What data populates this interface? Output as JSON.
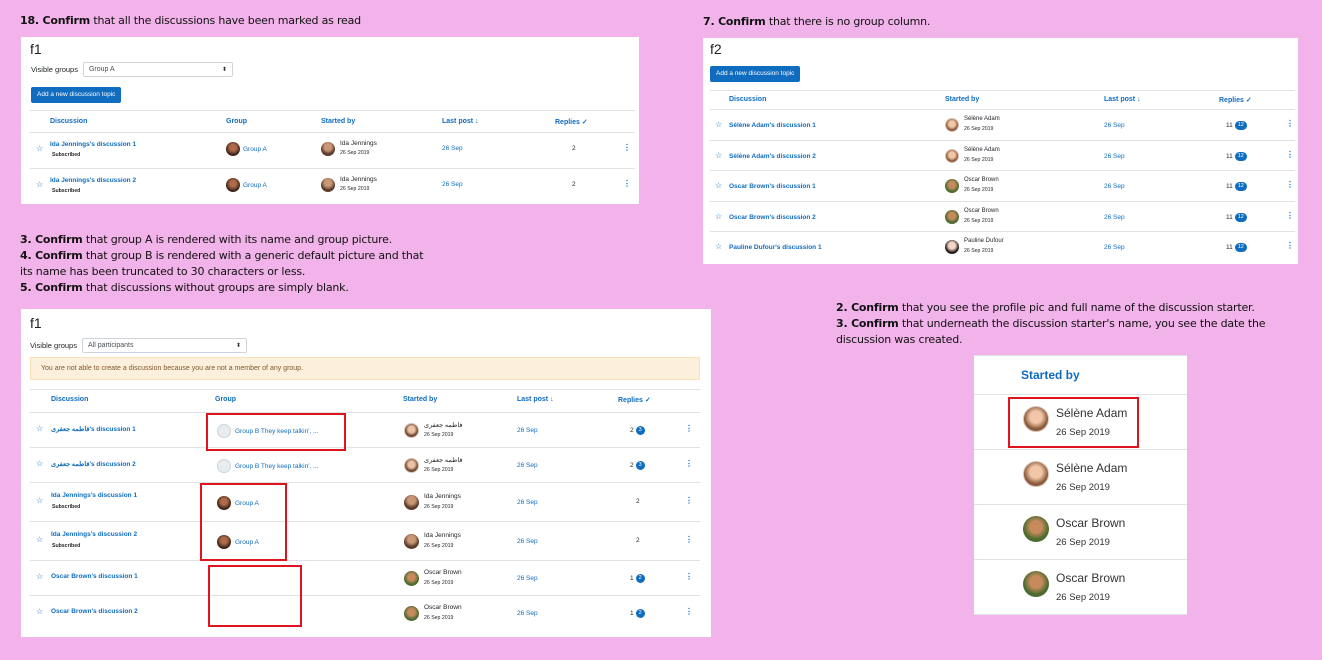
{
  "notes": {
    "n18_num": "18. ",
    "n18_bold": "Confirm",
    "n18_rest": " that all the discussions have been marked as read",
    "n7_num": "7. ",
    "n7_bold": "Confirm",
    "n7_rest": " that there  is no group column.",
    "n3_num": "3. ",
    "n3_bold": "Confirm",
    "n3_rest": " that group A is rendered with its name and group picture.",
    "n4_num": "4. ",
    "n4_bold": "Confirm",
    "n4_rest1": " that group B is rendered with a generic default picture and that",
    "n4_rest2": "its name has been truncated to 30 characters or less.",
    "n5_num": "5. ",
    "n5_bold": "Confirm",
    "n5_rest": " that discussions without groups are simply blank.",
    "n2b_num": "2. ",
    "n2b_bold": "Confirm",
    "n2b_rest": " that you see the profile pic and full name of the discussion starter.",
    "n3b_num": "3. ",
    "n3b_bold": "Confirm",
    "n3b_rest1": " that underneath the discussion starter's name, you see the date the",
    "n3b_rest2": "discussion was created."
  },
  "panel1": {
    "title": "f1",
    "visible_groups_label": "Visible groups",
    "group_select": "Group A",
    "add_button": "Add a new discussion topic",
    "headers": {
      "discussion": "Discussion",
      "group": "Group",
      "started_by": "Started by",
      "last_post": "Last post",
      "last_post_arrow": "↓",
      "replies": "Replies",
      "replies_check": "✓"
    },
    "rows": [
      {
        "title": "Ida Jennings's discussion 1",
        "sub": "Subscribed",
        "group": "Group A",
        "author": "Ida Jennings",
        "date": "26 Sep 2019",
        "last": "26 Sep",
        "replies": "2"
      },
      {
        "title": "Ida Jennings's discussion 2",
        "sub": "Subscribed",
        "group": "Group A",
        "author": "Ida Jennings",
        "date": "26 Sep 2019",
        "last": "26 Sep",
        "replies": "2"
      }
    ]
  },
  "panel2": {
    "title": "f2",
    "add_button": "Add a new discussion topic",
    "headers": {
      "discussion": "Discussion",
      "started_by": "Started by",
      "last_post": "Last post",
      "last_post_arrow": "↓",
      "replies": "Replies",
      "replies_check": "✓"
    },
    "rows": [
      {
        "title": "Sélène Adam's discussion 1",
        "author": "Sélène Adam",
        "date": "26 Sep 2019",
        "last": "26 Sep",
        "replies": "11",
        "unread": "12",
        "avatar": "sel"
      },
      {
        "title": "Sélène Adam's discussion 2",
        "author": "Sélène Adam",
        "date": "26 Sep 2019",
        "last": "26 Sep",
        "replies": "11",
        "unread": "12",
        "avatar": "sel"
      },
      {
        "title": "Oscar Brown's discussion 1",
        "author": "Oscar Brown",
        "date": "26 Sep 2019",
        "last": "26 Sep",
        "replies": "11",
        "unread": "12",
        "avatar": "osc"
      },
      {
        "title": "Oscar Brown's discussion 2",
        "author": "Oscar Brown",
        "date": "26 Sep 2019",
        "last": "26 Sep",
        "replies": "11",
        "unread": "12",
        "avatar": "osc"
      },
      {
        "title": "Pauline Dufour's discussion 1",
        "author": "Pauline Dufour",
        "date": "26 Sep 2019",
        "last": "26 Sep",
        "replies": "11",
        "unread": "12",
        "avatar": "pau"
      }
    ]
  },
  "panel3": {
    "title": "f1",
    "visible_groups_label": "Visible groups",
    "group_select": "All participants",
    "alert": "You are not able to create a discussion because you are not a member of any group.",
    "headers": {
      "discussion": "Discussion",
      "group": "Group",
      "started_by": "Started by",
      "last_post": "Last post",
      "last_post_arrow": "↓",
      "replies": "Replies",
      "replies_check": "✓"
    },
    "rows": [
      {
        "title": "فاطمه جعفری's discussion 1",
        "sub": "",
        "group": "Group B They keep talkin', ...",
        "gav": "def",
        "author": "فاطمه جعفری",
        "avatar": "fat",
        "date": "26 Sep 2019",
        "last": "26 Sep",
        "replies": "2",
        "unread": "3"
      },
      {
        "title": "فاطمه جعفری's discussion 2",
        "sub": "",
        "group": "Group B They keep talkin', ...",
        "gav": "def",
        "author": "فاطمه جعفری",
        "avatar": "fat",
        "date": "26 Sep 2019",
        "last": "26 Sep",
        "replies": "2",
        "unread": "3"
      },
      {
        "title": "Ida Jennings's discussion 1",
        "sub": "Subscribed",
        "group": "Group A",
        "gav": "group",
        "author": "Ida Jennings",
        "avatar": "ida",
        "date": "26 Sep 2019",
        "last": "26 Sep",
        "replies": "2",
        "unread": ""
      },
      {
        "title": "Ida Jennings's discussion 2",
        "sub": "Subscribed",
        "group": "Group A",
        "gav": "group",
        "author": "Ida Jennings",
        "avatar": "ida",
        "date": "26 Sep 2019",
        "last": "26 Sep",
        "replies": "2",
        "unread": ""
      },
      {
        "title": "Oscar Brown's discussion 1",
        "sub": "",
        "group": "",
        "gav": "",
        "author": "Oscar Brown",
        "avatar": "osc",
        "date": "26 Sep 2019",
        "last": "26 Sep",
        "replies": "1",
        "unread": "2"
      },
      {
        "title": "Oscar Brown's discussion 2",
        "sub": "",
        "group": "",
        "gav": "",
        "author": "Oscar Brown",
        "avatar": "osc",
        "date": "26 Sep 2019",
        "last": "26 Sep",
        "replies": "1",
        "unread": "2"
      }
    ]
  },
  "zoom": {
    "header": "Started by",
    "rows": [
      {
        "name": "Sélène Adam",
        "date": "26 Sep 2019",
        "avatar": "sel"
      },
      {
        "name": "Sélène Adam",
        "date": "26 Sep 2019",
        "avatar": "sel"
      },
      {
        "name": "Oscar Brown",
        "date": "26 Sep 2019",
        "avatar": "osc"
      },
      {
        "name": "Oscar Brown",
        "date": "26 Sep 2019",
        "avatar": "osc"
      }
    ]
  },
  "icons": {
    "star": "☆",
    "kebab": "⋮",
    "caret": "⬍"
  }
}
